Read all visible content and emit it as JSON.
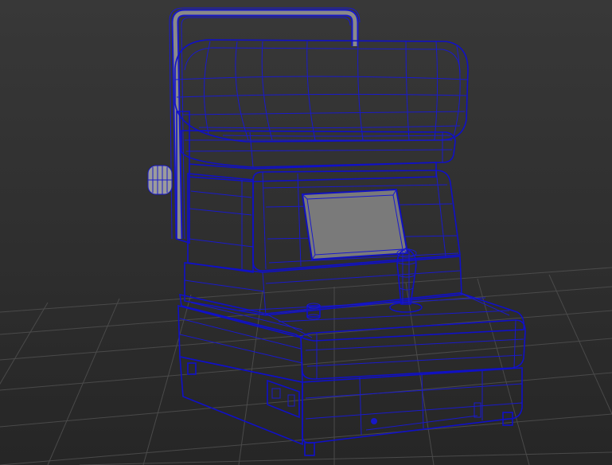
{
  "viewport": {
    "background": "#2d2d2d",
    "grid_color": "#4a4a4a",
    "wire_color": "#1a1acc",
    "object": "autorefractor-device-wireframe"
  }
}
